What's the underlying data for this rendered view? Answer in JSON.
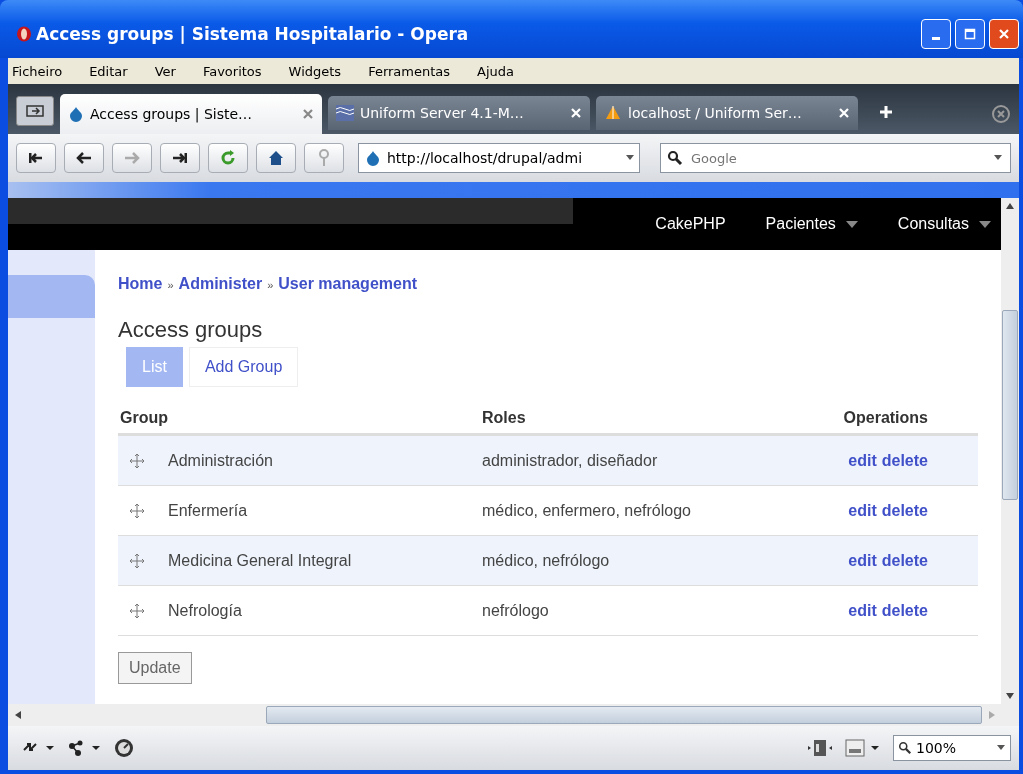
{
  "window": {
    "title": "Access groups | Sistema Hospitalario - Opera"
  },
  "menu": [
    "Ficheiro",
    "Editar",
    "Ver",
    "Favoritos",
    "Widgets",
    "Ferramentas",
    "Ajuda"
  ],
  "tabs": [
    {
      "label": "Access groups | Siste…",
      "selected": true
    },
    {
      "label": "Uniform Server 4.1-M…",
      "selected": false
    },
    {
      "label": "localhost / Uniform Ser…",
      "selected": false
    }
  ],
  "address": {
    "value": "http://localhost/drupal/admi"
  },
  "search": {
    "placeholder": "Google"
  },
  "page": {
    "nav": [
      {
        "label": "CakePHP",
        "dropdown": false
      },
      {
        "label": "Pacientes",
        "dropdown": true
      },
      {
        "label": "Consultas",
        "dropdown": true
      }
    ],
    "breadcrumb": [
      "Home",
      "Administer",
      "User management"
    ],
    "breadcrumb_separator": "»",
    "title": "Access groups",
    "subtabs": [
      {
        "label": "List",
        "selected": true
      },
      {
        "label": "Add Group",
        "selected": false
      }
    ],
    "table": {
      "columns": [
        "Group",
        "Roles",
        "Operations"
      ],
      "rows": [
        {
          "group": "Administración",
          "roles": "administrador, diseñador",
          "operations": [
            "edit",
            "delete"
          ]
        },
        {
          "group": "Enfermería",
          "roles": "médico, enfermero, nefrólogo",
          "operations": [
            "edit",
            "delete"
          ]
        },
        {
          "group": "Medicina General Integral",
          "roles": "médico, nefrólogo",
          "operations": [
            "edit",
            "delete"
          ]
        },
        {
          "group": "Nefrología",
          "roles": "nefrólogo",
          "operations": [
            "edit",
            "delete"
          ]
        }
      ]
    },
    "update_button": "Update"
  },
  "status_bar": {
    "zoom": "100%"
  }
}
